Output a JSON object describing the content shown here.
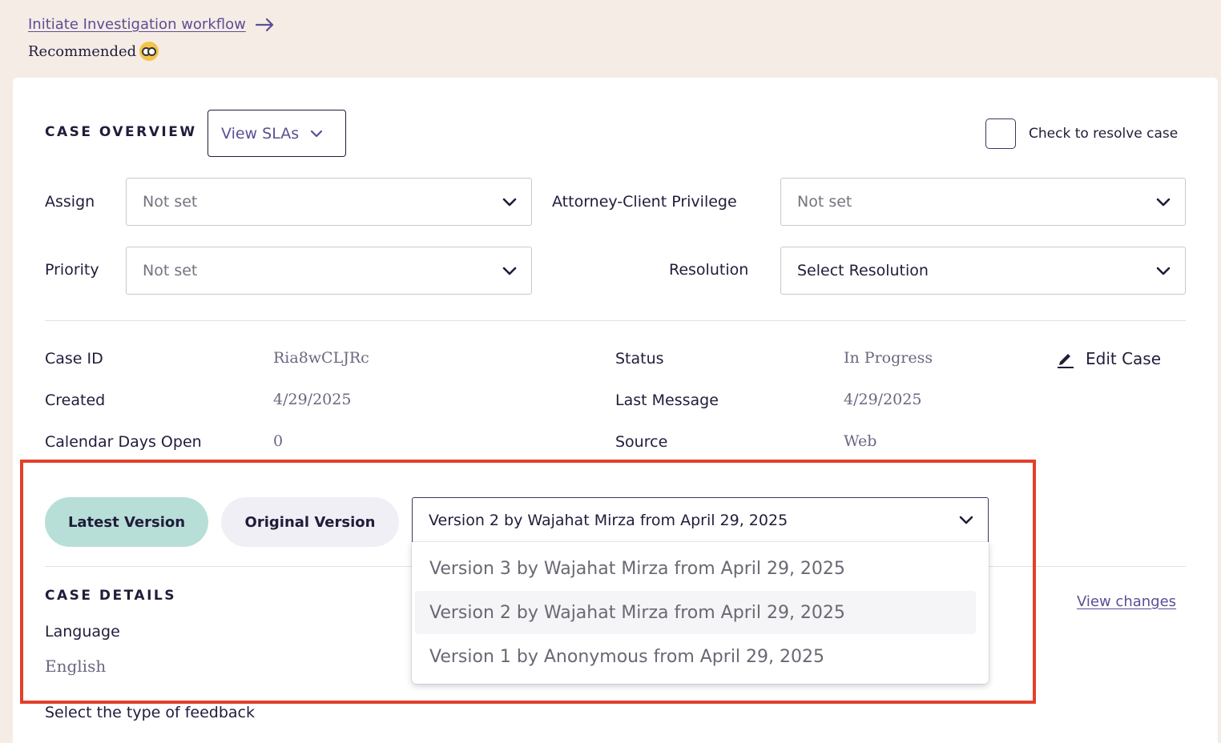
{
  "top": {
    "link_label": "Initiate Investigation workflow",
    "recommended_label": "Recommended"
  },
  "overview": {
    "title": "CASE OVERVIEW",
    "view_slas_label": "View SLAs",
    "resolve_label": "Check to resolve case",
    "resolve_checked": false
  },
  "fields": {
    "assign": {
      "label": "Assign",
      "value": "Not set"
    },
    "privilege": {
      "label": "Attorney-Client Privilege",
      "value": "Not set"
    },
    "priority": {
      "label": "Priority",
      "value": "Not set"
    },
    "resolution": {
      "label": "Resolution",
      "value": "Select Resolution"
    }
  },
  "info": {
    "case_id": {
      "label": "Case ID",
      "value": "Ria8wCLJRc"
    },
    "created": {
      "label": "Created",
      "value": "4/29/2025"
    },
    "days_open": {
      "label": "Calendar Days Open",
      "value": "0"
    },
    "status": {
      "label": "Status",
      "value": "In Progress"
    },
    "last_message": {
      "label": "Last Message",
      "value": "4/29/2025"
    },
    "source": {
      "label": "Source",
      "value": "Web"
    },
    "edit_label": "Edit Case"
  },
  "versions": {
    "latest_label": "Latest Version",
    "original_label": "Original Version",
    "selected": "Version 2 by Wajahat Mirza from April 29, 2025",
    "options": [
      "Version 3 by Wajahat Mirza from April 29, 2025",
      "Version 2 by Wajahat Mirza from April 29, 2025",
      "Version 1 by Anonymous from April 29, 2025"
    ]
  },
  "details": {
    "title": "CASE DETAILS",
    "view_changes_label": "View changes",
    "language_label": "Language",
    "language_value": "English",
    "feedback_label": "Select the type of feedback"
  },
  "colors": {
    "accent": "#5b4e94",
    "active_pill": "#b8ded8",
    "highlight": "#e2402a",
    "page_bg": "#f6ece6"
  }
}
